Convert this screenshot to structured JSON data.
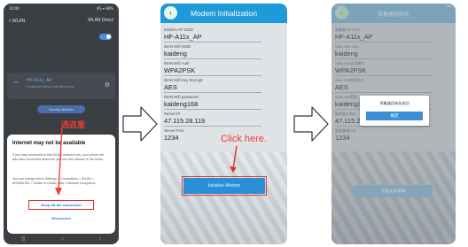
{
  "step1": {
    "status_time": "14:00",
    "status_right": "4G ▾ 98%",
    "header_title": "WLAN",
    "header_right": "WLAN Direct",
    "network_ssid": "HF-A11x_AP",
    "network_sub": "Connected without internet access",
    "security_button": "Security detection",
    "callout": "选这里",
    "dialog": {
      "title": "Internet may not be available",
      "body1": "If you stay connected to this WLAN network now, your phone will also stay connected whenever you use this network in the future.",
      "body2": "You can change this in Settings > Connections > WLAN > ADVANCED > Switch to mobile data > Network exceptions.",
      "keep_button": "Keep WLAN connection",
      "disconnect_button": "Disconnect"
    },
    "nav": {
      "recent": "|||",
      "home": "○",
      "back": "‹"
    }
  },
  "step2": {
    "title": "Modem Initialization",
    "fields": [
      {
        "label": "Modem AP SSID",
        "value": "HF-A11x_AP"
      },
      {
        "label": "WAN Wifi SSID",
        "value": "kaideng"
      },
      {
        "label": "WAN Wifi Auth",
        "value": "WPA2PSK"
      },
      {
        "label": "WAN Wifi Key Encrypt",
        "value": "AES"
      },
      {
        "label": "WAN Wifi password",
        "value": "kaideng168"
      },
      {
        "label": "Server IP",
        "value": "47.115.28.119"
      },
      {
        "label": "Server Port",
        "value": "1234"
      }
    ],
    "init_button": "Initialize Modem",
    "callout": "Click here."
  },
  "step3": {
    "status_left": "14:00",
    "status_right": "98%",
    "title": "采集器初始化",
    "fields": [
      {
        "label": "采集器 AP SSID",
        "value": "HF-A11x_AP"
      },
      {
        "label": "WAN Wifi SSID",
        "value": "kaideng"
      },
      {
        "label": "WAN Wifi认证模式",
        "value": "WPA2PSK"
      },
      {
        "label": "WAN Wifi加密方式",
        "value": "AES"
      },
      {
        "label": "WAN Wifi密码",
        "value": "kaideng168"
      },
      {
        "label": "服务器IP地址",
        "value": "47.115.28.119"
      },
      {
        "label": "服务器端口号",
        "value": "1234"
      }
    ],
    "init_button": "初始化采集器",
    "popup": {
      "message": "采集器初始化成功",
      "ok": "确定"
    }
  }
}
